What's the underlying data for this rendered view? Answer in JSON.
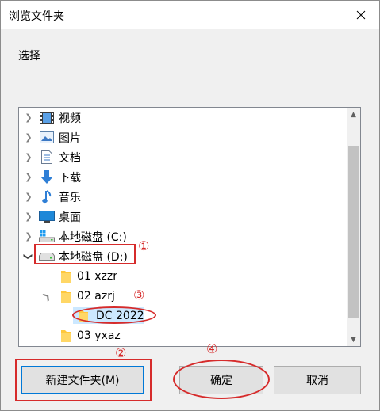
{
  "window": {
    "title": "浏览文件夹"
  },
  "prompt": "选择",
  "tree": {
    "items": [
      {
        "label": "视频",
        "icon": "video-icon"
      },
      {
        "label": "图片",
        "icon": "pictures-icon"
      },
      {
        "label": "文档",
        "icon": "documents-icon"
      },
      {
        "label": "下载",
        "icon": "download-icon"
      },
      {
        "label": "音乐",
        "icon": "music-icon"
      },
      {
        "label": "桌面",
        "icon": "desktop-icon"
      },
      {
        "label": "本地磁盘 (C:)",
        "icon": "windows-drive-icon"
      },
      {
        "label": "本地磁盘 (D:)",
        "icon": "drive-icon",
        "expanded": true
      },
      {
        "label": "01 xzzr",
        "icon": "folder-icon"
      },
      {
        "label": "02 azrj",
        "icon": "folder-icon"
      },
      {
        "label": "DC 2022",
        "icon": "folder-icon",
        "selected": true
      },
      {
        "label": "03 yxaz",
        "icon": "folder-icon"
      }
    ]
  },
  "buttons": {
    "new_folder": "新建文件夹(M)",
    "ok": "确定",
    "cancel": "取消"
  },
  "annotations": {
    "step1": "①",
    "step2": "②",
    "step3": "③",
    "step4": "④"
  },
  "colors": {
    "annotation_red": "#d62b2b",
    "focus_blue": "#0078d7",
    "folder_yellow": "#ffc83d"
  }
}
